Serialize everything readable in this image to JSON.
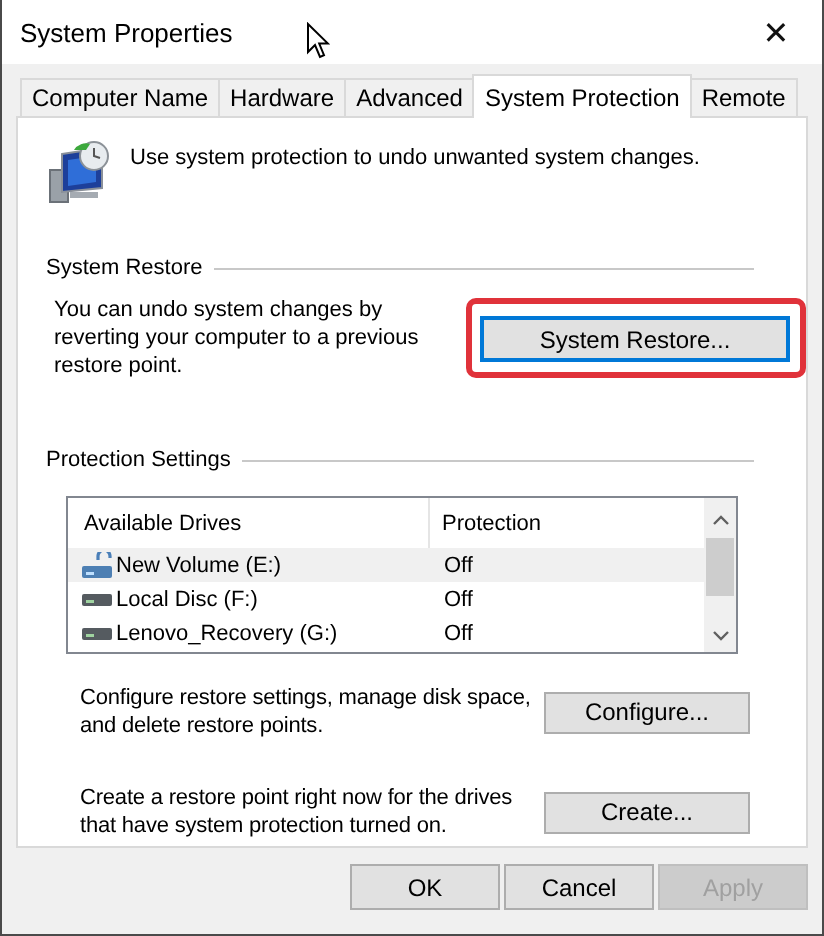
{
  "window": {
    "title": "System Properties",
    "close": "✕"
  },
  "tabs": [
    {
      "label": "Computer Name",
      "selected": false
    },
    {
      "label": "Hardware",
      "selected": false
    },
    {
      "label": "Advanced",
      "selected": false
    },
    {
      "label": "System Protection",
      "selected": true
    },
    {
      "label": "Remote",
      "selected": false
    }
  ],
  "intro": "Use system protection to undo unwanted system changes.",
  "system_restore": {
    "heading": "System Restore",
    "text": "You can undo system changes by reverting your computer to a previous restore point.",
    "button": {
      "label": "System Restore...",
      "focused": true,
      "highlighted": true
    }
  },
  "protection_settings": {
    "heading": "Protection Settings",
    "columns": [
      "Available Drives",
      "Protection"
    ],
    "rows": [
      {
        "kind": "system",
        "name": "New Volume (E:)",
        "protection": "Off",
        "selected": true
      },
      {
        "kind": "drive",
        "name": "Local Disc (F:)",
        "protection": "Off",
        "selected": false
      },
      {
        "kind": "drive",
        "name": "Lenovo_Recovery (G:)",
        "protection": "Off",
        "selected": false
      }
    ],
    "configure": {
      "text": "Configure restore settings, manage disk space, and delete restore points.",
      "button": "Configure..."
    },
    "create": {
      "text": "Create a restore point right now for the drives that have system protection turned on.",
      "button": "Create..."
    }
  },
  "buttons": [
    {
      "label": "OK",
      "disabled": false
    },
    {
      "label": "Cancel",
      "disabled": false
    },
    {
      "label": "Apply",
      "disabled": true
    }
  ]
}
